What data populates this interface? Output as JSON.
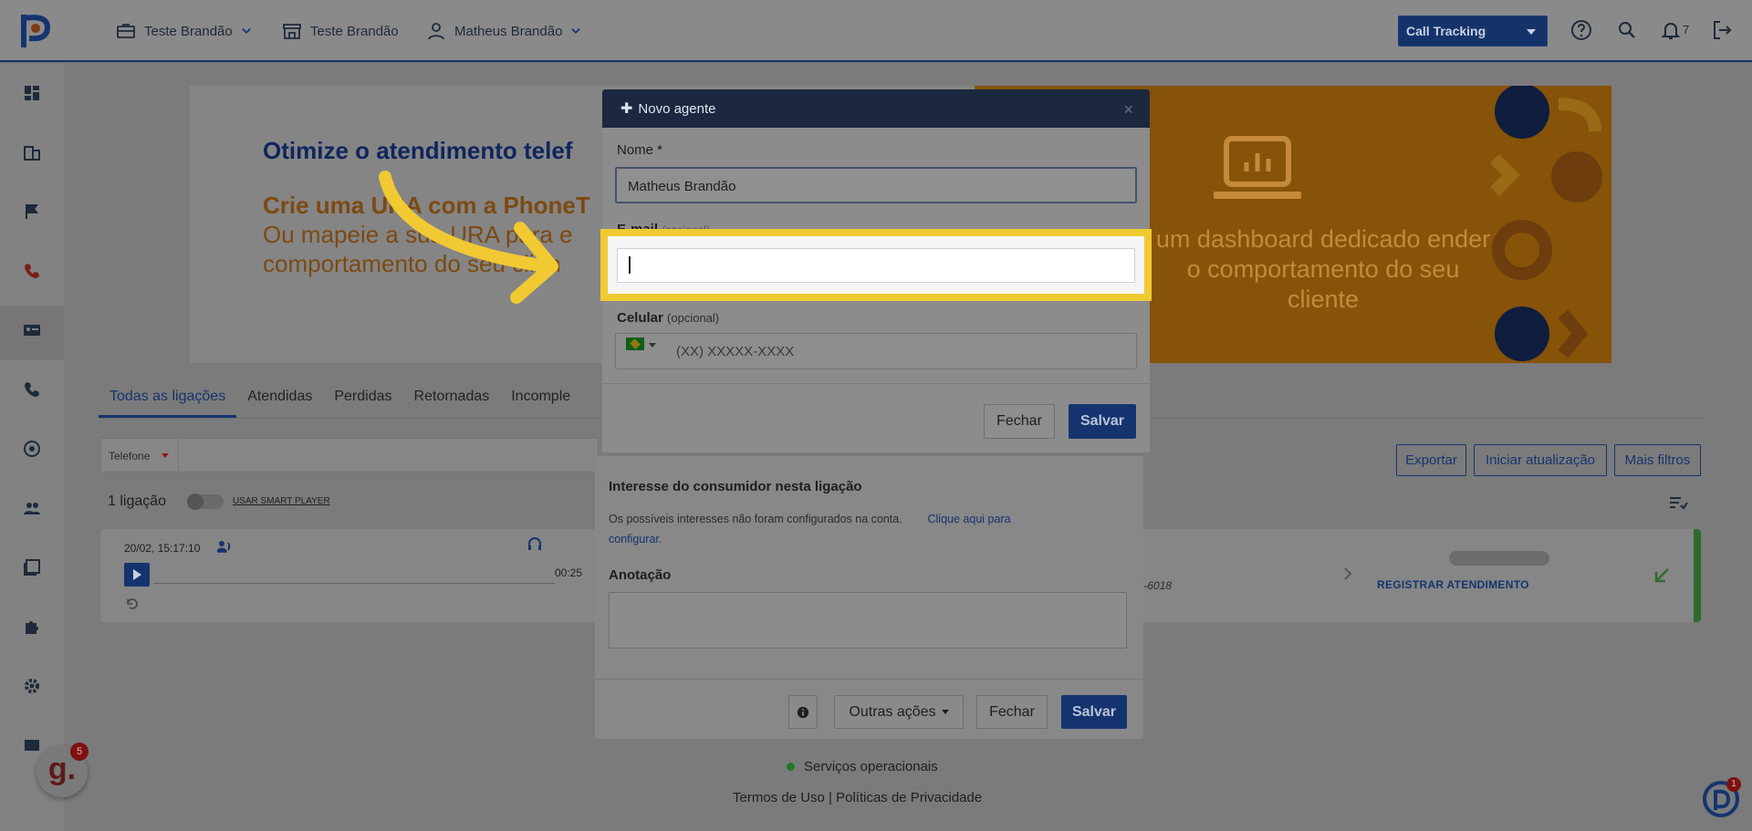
{
  "topbar": {
    "company_1": "Teste Brandão",
    "company_2": "Teste Brandão",
    "user": "Matheus Brandão",
    "product_select": "Call Tracking",
    "notifications_count": "7"
  },
  "banner": {
    "left_title": "Otimize o atendimento telef",
    "left_highlight": "Crie uma URA com a PhoneT",
    "left_line_2": "Ou mapeie a sua URA para e",
    "left_line_3": "comportamento do seu clien",
    "right_text": "um dashboard dedicado ender o comportamento do seu cliente"
  },
  "tabs": [
    "Todas as ligações",
    "Atendidas",
    "Perdidas",
    "Retornadas",
    "Incomple"
  ],
  "filters": {
    "phone_select": "Telefone",
    "export_button": "Exportar",
    "refresh_button": "Iniciar atualização",
    "more_filters_button": "Mais filtros"
  },
  "calls": {
    "count_label": "1 ligação",
    "smart_player_label": "USAR SMART PLAYER",
    "items": [
      {
        "date": "20/02, 15:17:10",
        "duration": "00:25",
        "phone_fragment": "92-6018",
        "register_link": "REGISTRAR ATENDIMENTO"
      }
    ]
  },
  "background_modal": {
    "interest_title": "Interesse do consumidor nesta ligação",
    "interest_text": "Os possíveis interesses não foram configurados na conta.",
    "interest_link_1": "Clique aqui para",
    "interest_link_2": "configurar.",
    "annotation_label": "Anotação",
    "other_actions_button": "Outras ações",
    "close_button": "Fechar",
    "save_button": "Salvar"
  },
  "modal": {
    "title": "Novo agente",
    "name_label": "Nome *",
    "name_value": "Matheus Brandão",
    "email_label": "E-mail",
    "email_optional": "(opcional)",
    "email_value": "",
    "phone_label": "Celular",
    "phone_optional": "(opcional)",
    "phone_placeholder": "(XX) XXXXX-XXXX",
    "close_button": "Fechar",
    "save_button": "Salvar"
  },
  "footer": {
    "status": "Serviços operacionais",
    "links": "Termos de Uso | Políticas de Privacidade"
  },
  "badges": {
    "g_letter": "g.",
    "g_count": "5",
    "help_count": "1"
  },
  "colors": {
    "accent": "#15346f",
    "highlight": "#f1c933",
    "banner_orange": "#865309",
    "status_green": "#1f7a2a"
  }
}
